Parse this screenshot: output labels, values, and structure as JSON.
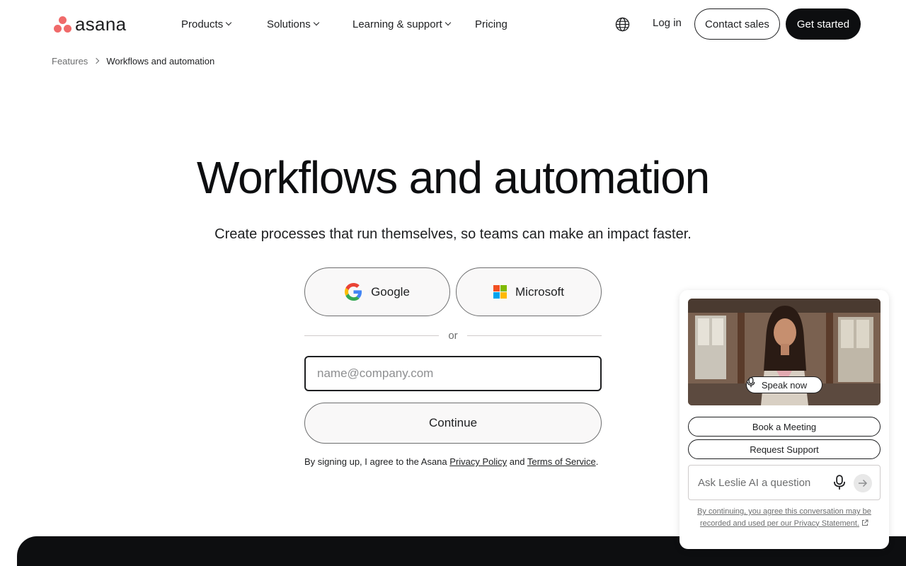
{
  "header": {
    "logo_text": "asana",
    "nav": [
      {
        "label": "Products"
      },
      {
        "label": "Solutions"
      },
      {
        "label": "Learning & support"
      },
      {
        "label": "Pricing"
      }
    ],
    "login_label": "Log in",
    "contact_label": "Contact sales",
    "get_started_label": "Get started"
  },
  "breadcrumb": {
    "parent": "Features",
    "current": "Workflows and automation"
  },
  "hero": {
    "title": "Workflows and automation",
    "subtitle": "Create processes that run themselves, so teams can make an impact faster."
  },
  "signup": {
    "google_label": "Google",
    "microsoft_label": "Microsoft",
    "divider_label": "or",
    "email_placeholder": "name@company.com",
    "email_value": "",
    "continue_label": "Continue",
    "legal_prefix": "By signing up, I agree to the Asana ",
    "privacy_label": "Privacy Policy",
    "legal_and": " and ",
    "terms_label": "Terms of Service",
    "legal_suffix": "."
  },
  "widget": {
    "speak_label": "Speak now",
    "book_label": "Book a Meeting",
    "support_label": "Request Support",
    "ask_placeholder": "Ask Leslie AI a question",
    "consent_text": "By continuing, you agree this conversation may be recorded and used per our Privacy Statement."
  },
  "colors": {
    "brand": "#f06a6a",
    "primary_dark": "#0d0e10",
    "text": "#1e1f21",
    "muted": "#6d6e6f"
  },
  "icons": [
    "asana-logo",
    "chevron-down-icon",
    "globe-icon",
    "chevron-right-icon",
    "google-icon",
    "microsoft-icon",
    "microphone-icon",
    "send-arrow-icon",
    "external-link-icon"
  ]
}
